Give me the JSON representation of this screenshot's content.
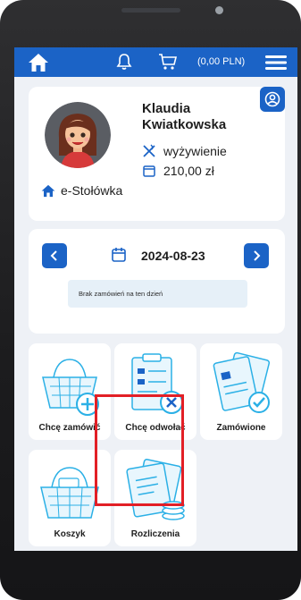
{
  "topbar": {
    "home_icon": "home-icon",
    "bell_icon": "bell-icon",
    "cart_icon": "cart-icon",
    "cart_total": "(0,00 PLN)",
    "menu_icon": "hamburger-icon"
  },
  "profile": {
    "first_name": "Klaudia",
    "last_name": "Kwiatkowska",
    "plan": "wyżywienie",
    "balance": "210,00 zł",
    "school": "e-Stołówka"
  },
  "date_panel": {
    "date": "2024-08-23",
    "empty_message": "Brak zamówień na ten dzień"
  },
  "tiles": [
    {
      "label": "Chcę zamówić"
    },
    {
      "label": "Chcę odwołać"
    },
    {
      "label": "Zamówione"
    },
    {
      "label": "Koszyk"
    },
    {
      "label": "Rozliczenia"
    }
  ],
  "colors": {
    "brand": "#1b63c6",
    "accent": "#2bb0e6",
    "highlight": "#e21f26"
  }
}
